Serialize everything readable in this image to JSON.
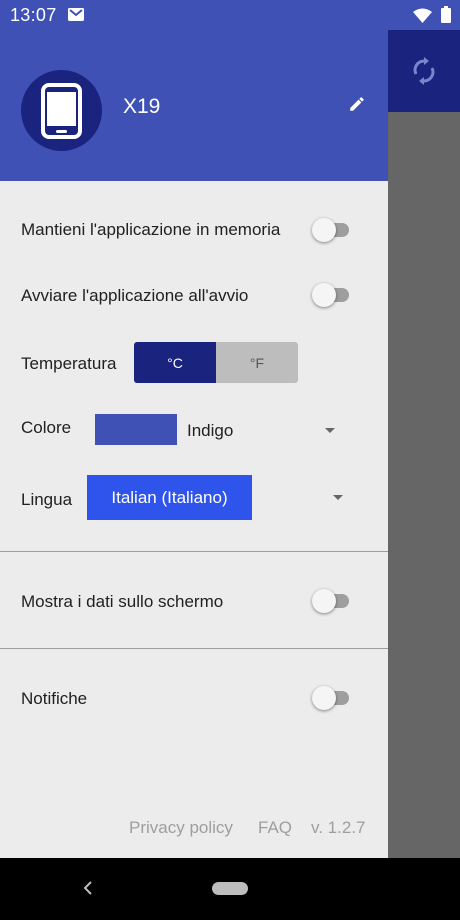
{
  "status": {
    "time": "13:07"
  },
  "header": {
    "device_name": "X19"
  },
  "settings": {
    "keep_in_memory": {
      "label": "Mantieni l'applicazione in memoria",
      "enabled": false
    },
    "start_on_boot": {
      "label": "Avviare l'applicazione all'avvio",
      "enabled": false
    },
    "temperature": {
      "label": "Temperatura",
      "options": [
        "°C",
        "°F"
      ],
      "selected": "°C"
    },
    "color": {
      "label": "Colore",
      "value": "Indigo",
      "swatch": "#3f51b5"
    },
    "language": {
      "label": "Lingua",
      "value": "Italian (Italiano)"
    },
    "show_on_screen": {
      "label": "Mostra i dati sullo schermo",
      "enabled": false
    },
    "notifications": {
      "label": "Notifiche",
      "enabled": false
    }
  },
  "footer": {
    "privacy_label": "Privacy policy",
    "faq_label": "FAQ",
    "version": "v. 1.2.7"
  },
  "icons": {
    "status": [
      "mail-icon",
      "wifi-icon",
      "battery-icon"
    ],
    "header": [
      "phone-icon",
      "edit-icon"
    ],
    "background": [
      "sync-icon"
    ],
    "navigation": [
      "back-icon",
      "home-icon"
    ]
  },
  "colors": {
    "primary": "#3f51b5",
    "primary_dark": "#1a237e",
    "language_select": "#2f54eb",
    "drawer_background": "#ececec"
  }
}
